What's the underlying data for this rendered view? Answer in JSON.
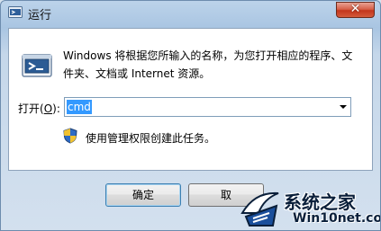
{
  "window": {
    "title": "运行",
    "close_glyph": "✕",
    "icon": "run-icon"
  },
  "dialog": {
    "description": "Windows 将根据您所输入的名称，为您打开相应的程序、文件夹、文档或 Internet 资源。",
    "open_label_prefix": "打开(",
    "open_label_key": "O",
    "open_label_suffix": "):",
    "command_value": "cmd",
    "admin_text": "使用管理权限创建此任务。"
  },
  "buttons": {
    "ok": "确定",
    "cancel": "取"
  },
  "watermark": {
    "brand": "系统之家",
    "site": "Win10net.com"
  },
  "colors": {
    "selection": "#3399ff",
    "close_button": "#c3351c",
    "title_bar": "#bcd3ea"
  }
}
